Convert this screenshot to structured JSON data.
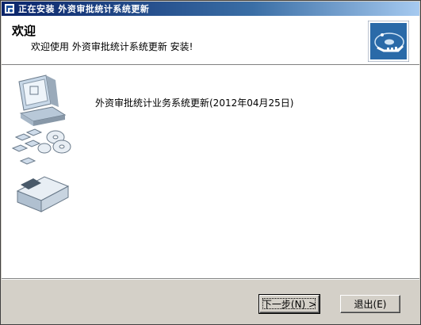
{
  "window": {
    "title": "正在安装 外资审批统计系统更新"
  },
  "header": {
    "title": "欢迎",
    "subtitle": "欢迎使用 外资审批统计系统更新 安装!"
  },
  "content": {
    "message": "外资审批统计业务系统更新(2012年04月25日)"
  },
  "buttons": {
    "next_label": "下一步(N) >",
    "exit_label": "退出(E)"
  },
  "icons": {
    "app": "installer-app-icon",
    "header_logo": "install-disc-logo",
    "illustration": "computer-with-disks-illustration"
  },
  "colors": {
    "titlebar_start": "#0a246a",
    "titlebar_end": "#a6caf0",
    "logo_bg": "#2a6aa8",
    "face": "#d4d0c8"
  }
}
